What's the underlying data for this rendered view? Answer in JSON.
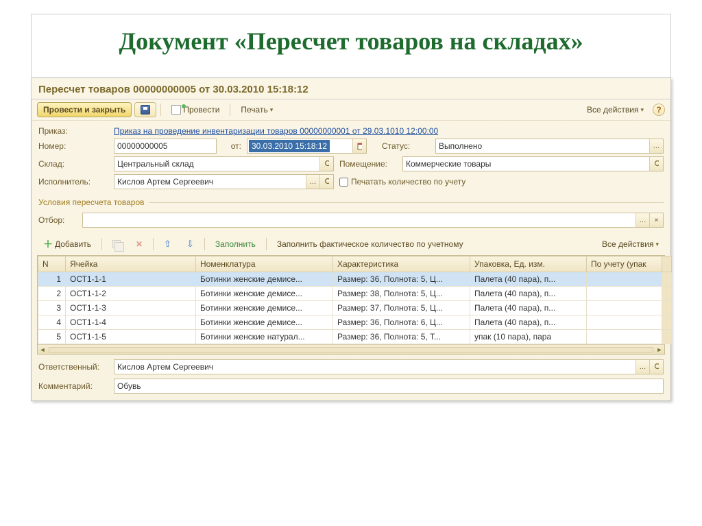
{
  "slide_title": "Документ «Пересчет товаров на складах»",
  "window_title": "Пересчет товаров 00000000005 от 30.03.2010 15:18:12",
  "toolbar": {
    "post_close": "Провести и закрыть",
    "post": "Провести",
    "print": "Печать",
    "all_actions": "Все действия",
    "help": "?"
  },
  "form": {
    "order_label": "Приказ:",
    "order_link": "Приказ на проведение инвентаризации товаров 00000000001 от 29.03.1010 12:00:00",
    "number_label": "Номер:",
    "number": "00000000005",
    "date_label": "от:",
    "date": "30.03.2010 15:18:12",
    "status_label": "Статус:",
    "status": "Выполнено",
    "warehouse_label": "Склад:",
    "warehouse": "Центральный склад",
    "room_label": "Помещение:",
    "room": "Коммерческие товары",
    "performer_label": "Исполнитель:",
    "performer": "Кислов Артем Сергеевич",
    "print_qty_chk": "Печатать количество по учету"
  },
  "section_conditions": "Условия пересчета товаров",
  "filter_label": "Отбор:",
  "table_toolbar": {
    "add": "Добавить",
    "fill": "Заполнить",
    "fill_by_account": "Заполнить фактическое количество по учетному",
    "all_actions": "Все действия"
  },
  "columns": {
    "n": "N",
    "cell": "Ячейка",
    "nomen": "Номенклатура",
    "char": "Характеристика",
    "pack": "Упаковка, Ед. изм.",
    "by_account": "По учету (упак"
  },
  "rows": [
    {
      "n": "1",
      "cell": "ОСТ1-1-1",
      "nomen": "Ботинки женские демисе...",
      "char": "Размер: 36, Полнота: 5, Ц...",
      "pack": "Палета (40 пара), п..."
    },
    {
      "n": "2",
      "cell": "ОСТ1-1-2",
      "nomen": "Ботинки женские демисе...",
      "char": "Размер: 38, Полнота: 5, Ц...",
      "pack": "Палета (40 пара), п..."
    },
    {
      "n": "3",
      "cell": "ОСТ1-1-3",
      "nomen": "Ботинки женские демисе...",
      "char": "Размер: 37, Полнота: 5, Ц...",
      "pack": "Палета (40 пара), п..."
    },
    {
      "n": "4",
      "cell": "ОСТ1-1-4",
      "nomen": "Ботинки женские демисе...",
      "char": "Размер: 36, Полнота: 6, Ц...",
      "pack": "Палета (40 пара), п..."
    },
    {
      "n": "5",
      "cell": "ОСТ1-1-5",
      "nomen": "Ботинки женские натурал...",
      "char": "Размер: 36, Полнота: 5, Т...",
      "pack": "упак (10 пара), пара"
    }
  ],
  "footer": {
    "responsible_label": "Ответственный:",
    "responsible": "Кислов Артем Сергеевич",
    "comment_label": "Комментарий:",
    "comment": "Обувь"
  }
}
